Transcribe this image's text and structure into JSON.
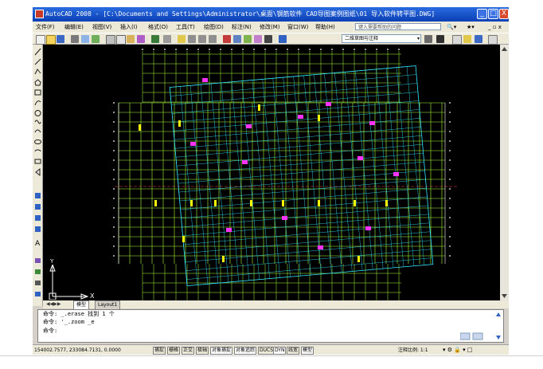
{
  "window": {
    "title": "AutoCAD 2008 - [C:\\Documents and Settings\\Administrator\\桌面\\钢筋软件 CAD导图案例图纸\\01 导入软件转平图.DWG]",
    "min_label": "_",
    "max_label": "□",
    "close_label": "X"
  },
  "menu": {
    "items": [
      "文件(F)",
      "编辑(E)",
      "视图(V)",
      "插入(I)",
      "格式(O)",
      "工具(T)",
      "绘图(D)",
      "标注(N)",
      "修改(M)",
      "窗口(W)",
      "帮助(H)"
    ],
    "help_placeholder": "键入需要帮助的问题"
  },
  "toolbar": {
    "layer_value": "二维草图与注释"
  },
  "canvas": {
    "ucs_y": "Y",
    "ucs_x": "X",
    "colors": {
      "background": "#000000",
      "grid": "#a9ff3a",
      "axis_white": "#ffffff",
      "magenta": "#ff33ff",
      "yellow": "#ffff00",
      "cyan": "#33e6ff"
    }
  },
  "tabs": {
    "model": "模型",
    "layout1": "Layout1"
  },
  "command": {
    "lines": [
      "命令: _.erase 找到 1 个",
      "命令: '_.zoom _e",
      "命令:"
    ]
  },
  "status": {
    "coords": "154002.7577, 233084.7131, 0.0000",
    "toggles": [
      "捕捉",
      "栅格",
      "正交",
      "极轴",
      "对象捕捉",
      "对象追踪",
      "DUCS",
      "DYN",
      "线宽",
      "模型"
    ],
    "annotation_scale": "注释比例: 1:1"
  }
}
